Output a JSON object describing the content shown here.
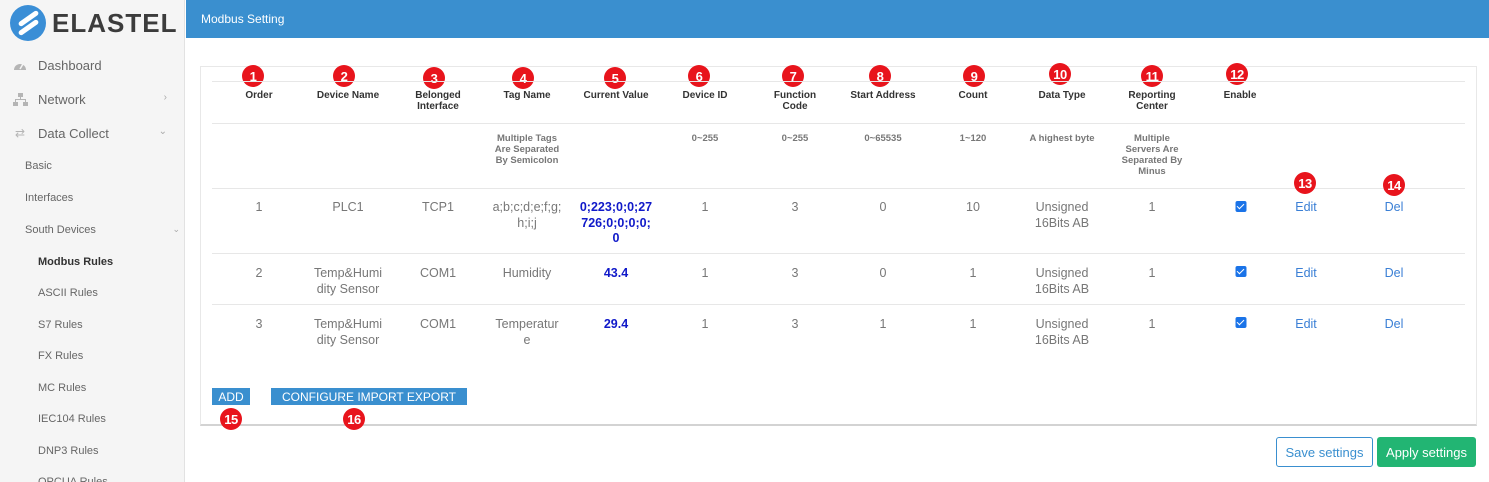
{
  "brand": {
    "logo_text": "ELASTEL"
  },
  "header": {
    "title": "Modbus Setting"
  },
  "sidebar": {
    "items": [
      {
        "label": "Dashboard",
        "icon": "dashboard-icon"
      },
      {
        "label": "Network",
        "icon": "network-icon"
      },
      {
        "label": "Data Collect",
        "icon": "exchange-icon"
      }
    ],
    "sub": {
      "basic": "Basic",
      "interfaces": "Interfaces",
      "south_devices": "South Devices",
      "rules": [
        "Modbus Rules",
        "ASCII Rules",
        "S7 Rules",
        "FX Rules",
        "MC Rules",
        "IEC104 Rules",
        "DNP3 Rules",
        "OPCUA Rules"
      ]
    }
  },
  "table": {
    "headers": {
      "order": "Order",
      "device_name": "Device Name",
      "interface": "Belonged Interface",
      "tag_name": "Tag Name",
      "current_value": "Current Value",
      "device_id": "Device ID",
      "function_code": "Function Code",
      "start_address": "Start Address",
      "count": "Count",
      "data_type": "Data Type",
      "reporting_center": "Reporting Center",
      "enable": "Enable"
    },
    "hints": {
      "tag_name": "Multiple Tags Are Separated By Semicolon",
      "device_id": "0~255",
      "function_code": "0~255",
      "start_address": "0~65535",
      "count": "1~120",
      "data_type": "A highest byte",
      "reporting_center": "Multiple Servers Are Separated By Minus"
    },
    "rows": [
      {
        "order": "1",
        "device_name": "PLC1",
        "interface": "TCP1",
        "tag_name": "a;b;c;d;e;f;g;h;i;j",
        "current_value": "0;223;0;0;27726;0;0;0;0;0",
        "device_id": "1",
        "function_code": "3",
        "start_address": "0",
        "count": "10",
        "data_type": "Unsigned 16Bits AB",
        "reporting_center": "1",
        "enabled": true,
        "edit": "Edit",
        "del": "Del"
      },
      {
        "order": "2",
        "device_name": "Temp&Humidity Sensor",
        "interface": "COM1",
        "tag_name": "Humidity",
        "current_value": "43.4",
        "device_id": "1",
        "function_code": "3",
        "start_address": "0",
        "count": "1",
        "data_type": "Unsigned 16Bits AB",
        "reporting_center": "1",
        "enabled": true,
        "edit": "Edit",
        "del": "Del"
      },
      {
        "order": "3",
        "device_name": "Temp&Humidity Sensor",
        "interface": "COM1",
        "tag_name": "Temperature",
        "current_value": "29.4",
        "device_id": "1",
        "function_code": "3",
        "start_address": "1",
        "count": "1",
        "data_type": "Unsigned 16Bits AB",
        "reporting_center": "1",
        "enabled": true,
        "edit": "Edit",
        "del": "Del"
      }
    ]
  },
  "buttons": {
    "add": "ADD",
    "config_import_export": "CONFIGURE IMPORT EXPORT",
    "save": "Save settings",
    "apply": "Apply settings"
  },
  "callouts": [
    "1",
    "2",
    "3",
    "4",
    "5",
    "6",
    "7",
    "8",
    "9",
    "10",
    "11",
    "12",
    "13",
    "14",
    "15",
    "16"
  ],
  "colors": {
    "header": "#3a8fcf",
    "callout": "#e8141c",
    "apply": "#22b573",
    "value": "#1019c9",
    "link": "#3a7fd5"
  }
}
